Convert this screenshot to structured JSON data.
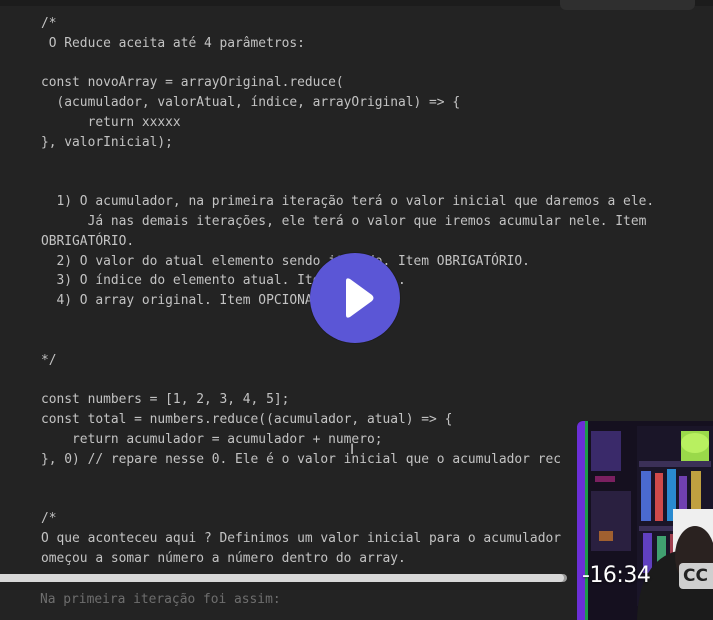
{
  "code_lines": [
    "/*",
    " O Reduce aceita até 4 parâmetros:",
    "",
    "const novoArray = arrayOriginal.reduce(",
    "  (acumulador, valorAtual, índice, arrayOriginal) => {",
    "      return xxxxx",
    "}, valorInicial);",
    "",
    "",
    "  1) O acumulador, na primeira iteração terá o valor inicial que daremos a ele.",
    "      Já nas demais iterações, ele terá o valor que iremos acumular nele. Item",
    "OBRIGATÓRIO.",
    "  2) O valor do atual elemento sendo iterado. Item OBRIGATÓRIO.",
    "  3) O índice do elemento atual. Item OPCIONAL.",
    "  4) O array original. Item OPCIONAL.",
    "",
    "",
    "*/",
    "",
    "const numbers = [1, 2, 3, 4, 5];",
    "const total = numbers.reduce((acumulador, atual) => {",
    "    return acumulador = acumulador + numero;",
    "}, 0) // repare nesse 0. Ele é o valor inicial que o acumulador rec",
    "",
    "",
    "/*",
    "O que aconteceu aqui ? Definimos um valor inicial para o acumulador",
    "omeçou a somar número a número dentro do array."
  ],
  "bottom_text": "Na primeira iteração foi assim:",
  "player": {
    "time_remaining": "-16:34",
    "cc_label": "CC",
    "progress": 0.995,
    "play_icon": "play-icon"
  },
  "colors": {
    "background": "#232323",
    "play_button": "#5b56d6",
    "number": "#e0a070"
  }
}
